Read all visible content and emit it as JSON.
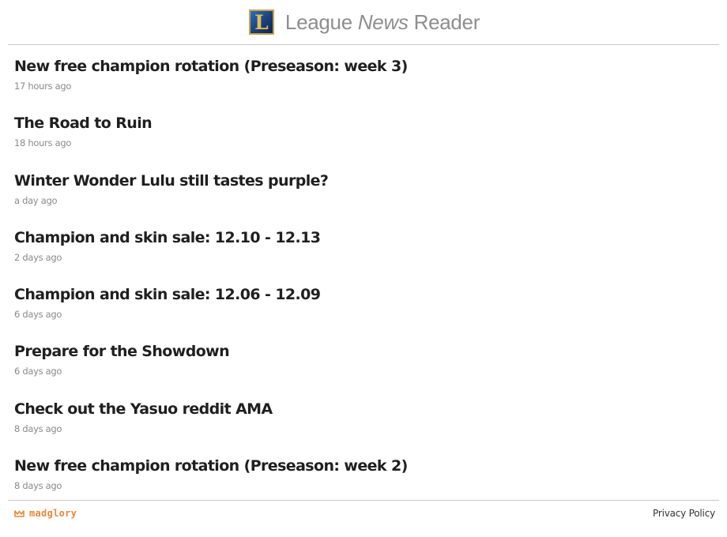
{
  "header": {
    "logo_letter": "L",
    "title_prefix": "League",
    "title_emphasis": "News",
    "title_suffix": "Reader"
  },
  "news": [
    {
      "title": "New free champion rotation (Preseason: week 3)",
      "time": "17 hours ago"
    },
    {
      "title": "The Road to Ruin",
      "time": "18 hours ago"
    },
    {
      "title": "Winter Wonder Lulu still tastes purple?",
      "time": "a day ago"
    },
    {
      "title": "Champion and skin sale: 12.10 - 12.13",
      "time": "2 days ago"
    },
    {
      "title": "Champion and skin sale: 12.06 - 12.09",
      "time": "6 days ago"
    },
    {
      "title": "Prepare for the Showdown",
      "time": "6 days ago"
    },
    {
      "title": "Check out the Yasuo reddit AMA",
      "time": "8 days ago"
    },
    {
      "title": "New free champion rotation (Preseason: week 2)",
      "time": "8 days ago"
    }
  ],
  "footer": {
    "brand": "madglory",
    "brand_icon": "madglory-logo-icon",
    "privacy": "Privacy Policy"
  },
  "colors": {
    "brand_orange": "#e8883a",
    "logo_gold": "#c9a34a",
    "logo_blue": "#1b3f7a",
    "title_gray": "#8e8e8e"
  }
}
